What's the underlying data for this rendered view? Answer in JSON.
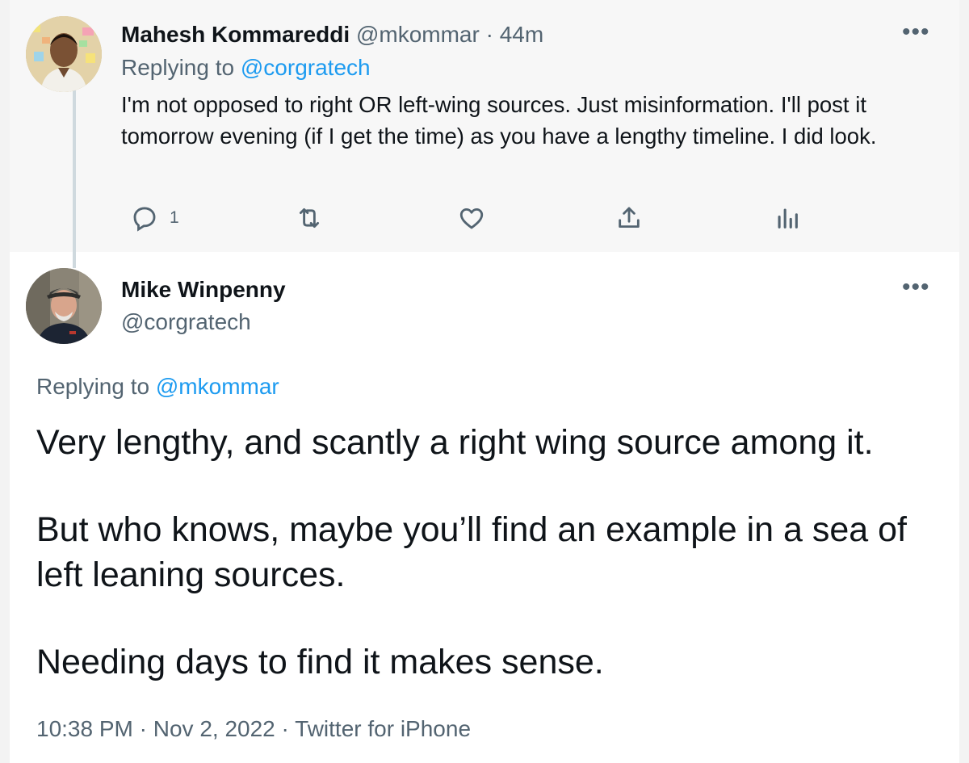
{
  "parent_tweet": {
    "author_name": "Mahesh Kommareddi",
    "author_handle": "@mkommar",
    "separator": "·",
    "time_ago": "44m",
    "replying_prefix": "Replying to",
    "replying_to": "@corgratech",
    "text": "I'm not opposed to right OR left-wing sources. Just misinformation. I'll post it tomorrow evening (if I get the time) as you have a lengthy timeline. I did look.",
    "more_label": "•••",
    "actions": {
      "reply_icon": "reply-icon",
      "reply_count": "1",
      "retweet_icon": "retweet-icon",
      "like_icon": "heart-icon",
      "share_icon": "share-icon",
      "analytics_icon": "analytics-icon"
    }
  },
  "current_tweet": {
    "author_name": "Mike Winpenny",
    "author_handle": "@corgratech",
    "more_label": "•••",
    "replying_prefix": "Replying to",
    "replying_to": "@mkommar",
    "paragraphs": [
      "Very lengthy, and scantly a right wing source among it.",
      "But who knows, maybe you’ll find an example in a sea of left leaning sources.",
      "Needing days to find it makes sense."
    ],
    "time": "10:38 PM",
    "meta_separator": "·",
    "date": "Nov 2, 2022",
    "source": "Twitter for iPhone"
  },
  "colors": {
    "link": "#1d9bf0",
    "muted": "#536471",
    "text": "#0f1419",
    "parent_bg": "#f7f7f7",
    "thread_line": "#cfd9de"
  }
}
